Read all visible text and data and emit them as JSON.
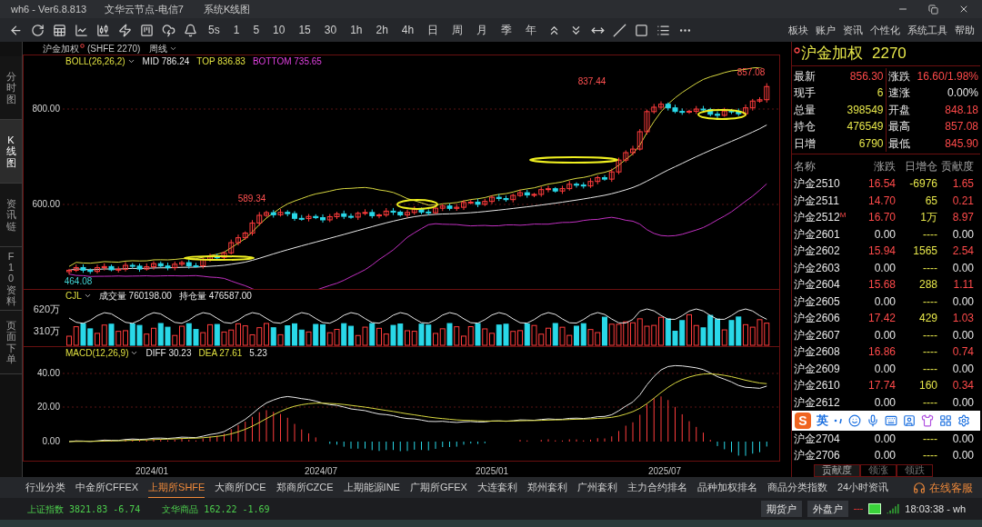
{
  "window": {
    "title": "wh6 - Ver6.8.813",
    "server": "文华云节点-电信7",
    "view": "系统K线图"
  },
  "toolbar": {
    "periods": [
      "5s",
      "1",
      "5",
      "10",
      "15",
      "30",
      "1h",
      "2h",
      "4h",
      "日",
      "周",
      "月",
      "季",
      "年"
    ],
    "menus": [
      "板块",
      "账户",
      "资讯",
      "个性化",
      "系统工具",
      "帮助"
    ]
  },
  "side_tabs": [
    {
      "label": "分时图",
      "selected": false
    },
    {
      "label": "K线图",
      "selected": true
    },
    {
      "label": "资讯链",
      "selected": false
    },
    {
      "label": "F10资料",
      "selected": false
    },
    {
      "label": "页面下单",
      "selected": false
    }
  ],
  "chart": {
    "symbol": "沪金加权",
    "code": "(SHFE 2270)",
    "period": "周线",
    "main": {
      "indicator": "BOLL(26,26,2)",
      "legend": [
        {
          "label": "MID",
          "value": "786.24",
          "color": "#e8e8e8"
        },
        {
          "label": "TOP",
          "value": "836.83",
          "color": "#e0e040"
        },
        {
          "label": "BOTTOM",
          "value": "735.65",
          "color": "#e040e0"
        }
      ],
      "yticks": [
        "800.00",
        "600.00"
      ],
      "marks": [
        "589.34",
        "837.44",
        "857.08",
        "464.08"
      ]
    },
    "volume": {
      "indicator": "CJL",
      "legend": [
        {
          "label": "成交量",
          "value": "760198.00"
        },
        {
          "label": "持仓量",
          "value": "476587.00"
        }
      ],
      "yticks": [
        "620万",
        "310万"
      ]
    },
    "macd": {
      "indicator": "MACD(12,26,9)",
      "legend": [
        {
          "label": "DIFF",
          "value": "30.23",
          "color": "#e8e8e8"
        },
        {
          "label": "DEA",
          "value": "27.61",
          "color": "#e0e040"
        },
        {
          "value": "5.23"
        }
      ],
      "yticks": [
        "40.00",
        "20.00",
        "0.00"
      ]
    },
    "xlabels": [
      "2024/01",
      "2024/07",
      "2025/01",
      "2025/07"
    ]
  },
  "quote": {
    "title": "沪金加权",
    "code": "2270",
    "fields": [
      {
        "label": "最新",
        "value": "856.30",
        "color": "#ff4a4a"
      },
      {
        "label": "涨跌",
        "value": "16.60/1.98%",
        "color": "#ff4a4a"
      },
      {
        "label": "现手",
        "value": "6",
        "color": "#e6e64a"
      },
      {
        "label": "速涨",
        "value": "0.00%",
        "color": "#e8e8e8"
      },
      {
        "label": "总量",
        "value": "398549",
        "color": "#e6e64a"
      },
      {
        "label": "开盘",
        "value": "848.18",
        "color": "#ff4a4a"
      },
      {
        "label": "持仓",
        "value": "476549",
        "color": "#e6e64a"
      },
      {
        "label": "最高",
        "value": "857.08",
        "color": "#ff4a4a"
      },
      {
        "label": "日增",
        "value": "6790",
        "color": "#e6e64a"
      },
      {
        "label": "最低",
        "value": "845.90",
        "color": "#ff4a4a"
      }
    ]
  },
  "contracts": {
    "columns": [
      "名称",
      "涨跌",
      "日增仓",
      "贡献度"
    ],
    "rows": [
      {
        "name": "沪金2510",
        "change": "16.54",
        "oi_change": "-6976",
        "contribution": "1.65",
        "color": "#ff4a4a"
      },
      {
        "name": "沪金2511",
        "change": "14.70",
        "oi_change": "65",
        "contribution": "0.21",
        "color": "#ff4a4a"
      },
      {
        "name": "沪金2512",
        "mark": "M",
        "change": "16.70",
        "oi_change": "1万",
        "contribution": "8.97",
        "color": "#ff4a4a"
      },
      {
        "name": "沪金2601",
        "change": "0.00",
        "oi_change": "----",
        "contribution": "0.00",
        "color": "#e8e8e8"
      },
      {
        "name": "沪金2602",
        "change": "15.94",
        "oi_change": "1565",
        "contribution": "2.54",
        "color": "#ff4a4a"
      },
      {
        "name": "沪金2603",
        "change": "0.00",
        "oi_change": "----",
        "contribution": "0.00",
        "color": "#e8e8e8"
      },
      {
        "name": "沪金2604",
        "change": "15.68",
        "oi_change": "288",
        "contribution": "1.11",
        "color": "#ff4a4a"
      },
      {
        "name": "沪金2605",
        "change": "0.00",
        "oi_change": "----",
        "contribution": "0.00",
        "color": "#e8e8e8"
      },
      {
        "name": "沪金2606",
        "change": "17.42",
        "oi_change": "429",
        "contribution": "1.03",
        "color": "#ff4a4a"
      },
      {
        "name": "沪金2607",
        "change": "0.00",
        "oi_change": "----",
        "contribution": "0.00",
        "color": "#e8e8e8"
      },
      {
        "name": "沪金2608",
        "change": "16.86",
        "oi_change": "----",
        "contribution": "0.74",
        "color": "#ff4a4a"
      },
      {
        "name": "沪金2609",
        "change": "0.00",
        "oi_change": "----",
        "contribution": "0.00",
        "color": "#e8e8e8"
      },
      {
        "name": "沪金2610",
        "change": "17.74",
        "oi_change": "160",
        "contribution": "0.34",
        "color": "#ff4a4a"
      },
      {
        "name": "沪金2612",
        "change": "0.00",
        "oi_change": "----",
        "contribution": "0.00",
        "color": "#e8e8e8"
      }
    ],
    "rows_below_overlay": [
      {
        "name": "沪金2704",
        "change": "0.00",
        "oi_change": "----",
        "contribution": "0.00",
        "color": "#e8e8e8"
      },
      {
        "name": "沪金2706",
        "change": "0.00",
        "oi_change": "----",
        "contribution": "0.00",
        "color": "#e8e8e8"
      }
    ],
    "tabs": [
      {
        "label": "贡献度",
        "selected": true
      },
      {
        "label": "领涨",
        "selected": false
      },
      {
        "label": "领跌",
        "selected": false
      }
    ]
  },
  "ime_toolbar": {
    "logo": "S",
    "mode": "英"
  },
  "market_tabs": [
    {
      "label": "行业分类",
      "selected": false
    },
    {
      "label": "中金所CFFEX",
      "selected": false
    },
    {
      "label": "上期所SHFE",
      "selected": true
    },
    {
      "label": "大商所DCE",
      "selected": false
    },
    {
      "label": "郑商所CZCE",
      "selected": false
    },
    {
      "label": "上期能源INE",
      "selected": false
    },
    {
      "label": "广期所GFEX",
      "selected": false
    },
    {
      "label": "大连套利",
      "selected": false
    },
    {
      "label": "郑州套利",
      "selected": false
    },
    {
      "label": "广州套利",
      "selected": false
    },
    {
      "label": "主力合约排名",
      "selected": false
    },
    {
      "label": "品种加权排名",
      "selected": false
    },
    {
      "label": "商品分类指数",
      "selected": false
    },
    {
      "label": "24小时资讯",
      "selected": false
    }
  ],
  "service": "在线客服",
  "status_bar": {
    "indices": [
      {
        "name": "上证指数",
        "value": "3821.83",
        "change": "-6.74"
      },
      {
        "name": "文华商品",
        "value": "162.22",
        "change": "-1.69"
      }
    ],
    "accounts": [
      "期货户",
      "外盘户"
    ],
    "time": "18:03:38 - wh"
  }
}
